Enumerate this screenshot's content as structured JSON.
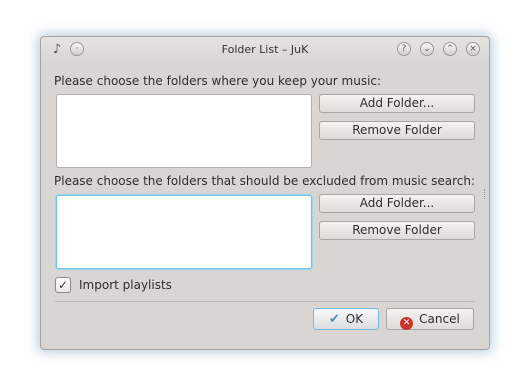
{
  "window": {
    "title": "Folder List – JuK",
    "app_icon": "music-note-icon",
    "controls": [
      "help-icon",
      "minimize-icon",
      "maximize-icon",
      "close-icon"
    ],
    "control_glyphs": {
      "help": "?",
      "minimize": "⌄",
      "maximize": "⌃",
      "close": "×",
      "pin": "·"
    }
  },
  "music_folders": {
    "label": "Please choose the folders where you keep your music:",
    "items": [],
    "add_button": "Add Folder...",
    "remove_button": "Remove Folder"
  },
  "excluded_folders": {
    "label": "Please choose the folders that should be excluded from music search:",
    "items": [],
    "add_button": "Add Folder...",
    "remove_button": "Remove Folder"
  },
  "import_playlists": {
    "label": "Import playlists",
    "checked": true,
    "check_glyph": "✓"
  },
  "footer": {
    "ok_label": "OK",
    "ok_icon": "checkmark-icon",
    "ok_glyph": "✔",
    "cancel_label": "Cancel",
    "cancel_icon": "cancel-icon",
    "cancel_glyph": "✕"
  },
  "colors": {
    "window_bg": "#d8d5d2",
    "focus_accent": "#6fc0e6",
    "cancel_red": "#c8342b"
  }
}
